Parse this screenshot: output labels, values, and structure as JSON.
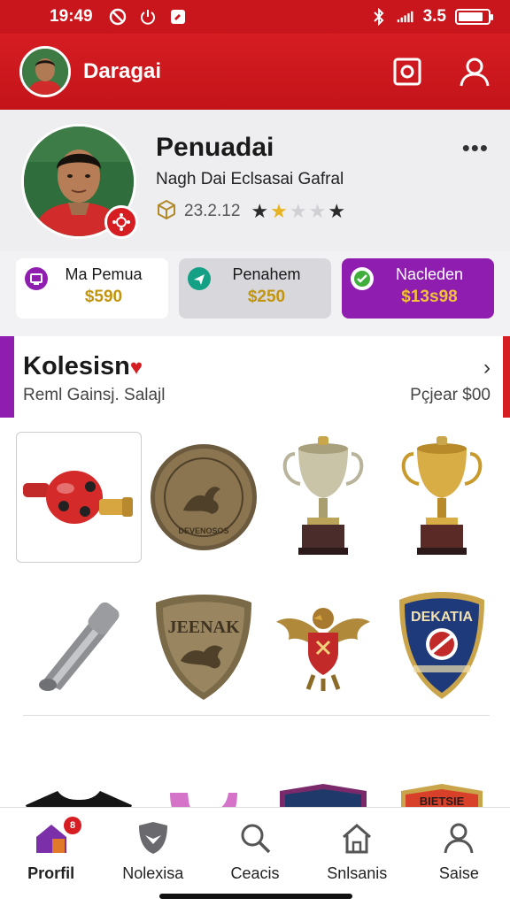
{
  "status_bar": {
    "time": "19:49",
    "network": "3.5",
    "battery_level": 0.85
  },
  "app_bar": {
    "title": "Daragai",
    "icons": [
      "avatar",
      "camera-icon",
      "user-icon"
    ]
  },
  "profile": {
    "name": "Penuadai",
    "subtitle": "Nagh Dai Eclsasai Gafral",
    "meta_value": "23.2.12",
    "rating": 2,
    "rating_max": 5,
    "more": "•••"
  },
  "stats": [
    {
      "label": "Ma Pemua",
      "value": "$590",
      "icon": "tablet-icon"
    },
    {
      "label": "Penahem",
      "value": "$250",
      "icon": "plane-icon"
    },
    {
      "label": "Nacleden",
      "value": "$13s98",
      "icon": "check-icon"
    }
  ],
  "collection": {
    "title": "Kolesisn",
    "subtitle_left": "Reml Gainsj. Salajl",
    "subtitle_right": "Pçjear $00",
    "items": [
      "whistle-item",
      "coin-medal-item",
      "silver-trophy-item",
      "gold-trophy-item",
      "metal-whistle-item",
      "bronze-shield-item",
      "eagle-emblem-item",
      "blue-shield-item",
      "black-jersey-item",
      "pink-tank-top-item",
      "crest-badge-item",
      "red-shield-item"
    ],
    "coin_text": "DEVENOSOS",
    "shield_text": "JEENAK",
    "blue_shield_text": "DEKATIA",
    "red_shield_text": "BIETSIE"
  },
  "bottom_nav": {
    "items": [
      {
        "label": "Prorfil",
        "icon": "home-icon",
        "active": true,
        "badge": "8"
      },
      {
        "label": "Nolexisa",
        "icon": "shield-icon",
        "active": false
      },
      {
        "label": "Ceacis",
        "icon": "search-icon",
        "active": false
      },
      {
        "label": "Snlsanis",
        "icon": "house-icon",
        "active": false
      },
      {
        "label": "Saise",
        "icon": "person-icon",
        "active": false
      }
    ]
  },
  "colors": {
    "brand_red": "#d51d22",
    "accent_purple": "#8f1eb0",
    "gold": "#c2950f"
  }
}
